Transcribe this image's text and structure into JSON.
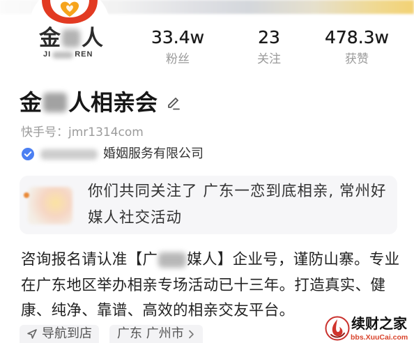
{
  "colors": {
    "text_primary": "#1e1e1e",
    "text_secondary": "#9a9a9a",
    "accent_blue": "#4b7ff2",
    "brand_red": "#e23a22",
    "brand_orange": "#f6a41c",
    "card_bg": "#f6f6f8",
    "chip_bg": "#f3f3f5",
    "watermark_url": "#d9432b"
  },
  "icons": {
    "avatar_logo": "heart-hands-logo-icon",
    "edit": "pencil-icon",
    "verified": "verified-badge-icon",
    "navigate": "navigation-arrow-icon",
    "location_more": "chevron-right-icon",
    "watermark_logo": "watermark-logo-icon"
  },
  "logo": {
    "char_left": "金",
    "char_right": "人",
    "latin_left": "JI",
    "latin_right": "REN"
  },
  "stats": [
    {
      "value": "33.4w",
      "label": "粉丝"
    },
    {
      "value": "23",
      "label": "关注"
    },
    {
      "value": "478.3w",
      "label": "获赞"
    }
  ],
  "profile": {
    "name_start": "金",
    "name_end": "人相亲会",
    "account": "快手号：jmr1314com",
    "company_suffix": "婚姻服务有限公司"
  },
  "mutual": {
    "lines": [
      "你们共同关注了 广东一恋到底相亲, 常州好",
      "媒人社交活动"
    ]
  },
  "bio": {
    "line1_start": "咨询报名请认准【广",
    "line1_end": "媒人】企业号，谨防山寨。专业",
    "line2": "在广东地区举办相亲专场活动已十三年。打造真实、健",
    "line3": "康、纯净、靠谱、高效的相亲交友平台。"
  },
  "chips": [
    {
      "label": "导航到店"
    },
    {
      "label": "广东 广州市"
    }
  ],
  "watermark": {
    "title": "续财之家",
    "url": "bbs.XuuCai.com"
  }
}
